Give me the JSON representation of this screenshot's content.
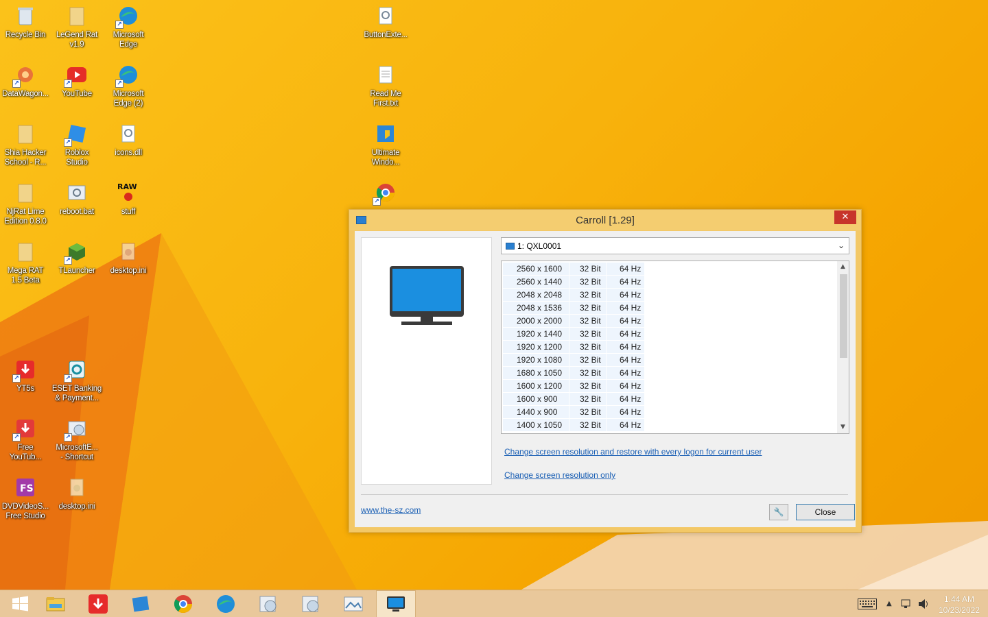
{
  "desktop": {
    "icons": [
      {
        "label": "Recycle Bin",
        "icon": "recycle-bin-icon"
      },
      {
        "label": "LeGend Rat\nv1.9",
        "icon": "folder-icon"
      },
      {
        "label": "Microsoft\nEdge",
        "icon": "edge-icon"
      },
      {
        "label": "ButtonExte...",
        "icon": "settings-file-icon"
      },
      {
        "label": "DataWagon...",
        "icon": "datawagon-icon"
      },
      {
        "label": "YouTube",
        "icon": "youtube-icon"
      },
      {
        "label": "Microsoft\nEdge (2)",
        "icon": "edge-icon"
      },
      {
        "label": "Read Me\nFirst.txt",
        "icon": "text-file-icon"
      },
      {
        "label": "Shia Hacker\nSchool - R...",
        "icon": "folder-icon"
      },
      {
        "label": "Roblox\nStudio",
        "icon": "roblox-studio-icon"
      },
      {
        "label": "icons.dll",
        "icon": "dll-file-icon"
      },
      {
        "label": "Ultimate\nWindo...",
        "icon": "ultimate-windows-icon"
      },
      {
        "label": "NjRat Lime\nEdition 0.8.0",
        "icon": "folder-icon"
      },
      {
        "label": "reboot.bat",
        "icon": "batch-file-icon"
      },
      {
        "label": "stuff",
        "icon": "raw-stuff-icon"
      },
      {
        "label": "",
        "icon": "chrome-icon"
      },
      {
        "label": "Mega RAT\n1.5 Beta",
        "icon": "folder-icon"
      },
      {
        "label": "TLauncher",
        "icon": "tlauncher-icon"
      },
      {
        "label": "desktop.ini",
        "icon": "ini-file-icon"
      },
      {
        "label": "YT5s",
        "icon": "yt5s-icon"
      },
      {
        "label": "ESET Banking\n& Payment...",
        "icon": "eset-icon"
      },
      {
        "label": "Free\nYouTub...",
        "icon": "free-youtube-icon"
      },
      {
        "label": "MicrosoftE...\n- Shortcut",
        "icon": "shortcut-icon"
      },
      {
        "label": "DVDVideoS...\nFree Studio",
        "icon": "dvdvideosoft-icon"
      },
      {
        "label": "desktop.ini",
        "icon": "ini-file-icon"
      }
    ]
  },
  "dialog": {
    "title": "Carroll [1.29]",
    "monitor_select": "1: QXL0001",
    "resolutions": [
      {
        "res": "2560 x 1600",
        "depth": "32 Bit",
        "hz": "64 Hz"
      },
      {
        "res": "2560 x 1440",
        "depth": "32 Bit",
        "hz": "64 Hz"
      },
      {
        "res": "2048 x 2048",
        "depth": "32 Bit",
        "hz": "64 Hz"
      },
      {
        "res": "2048 x 1536",
        "depth": "32 Bit",
        "hz": "64 Hz"
      },
      {
        "res": "2000 x 2000",
        "depth": "32 Bit",
        "hz": "64 Hz"
      },
      {
        "res": "1920 x 1440",
        "depth": "32 Bit",
        "hz": "64 Hz"
      },
      {
        "res": "1920 x 1200",
        "depth": "32 Bit",
        "hz": "64 Hz"
      },
      {
        "res": "1920 x 1080",
        "depth": "32 Bit",
        "hz": "64 Hz"
      },
      {
        "res": "1680 x 1050",
        "depth": "32 Bit",
        "hz": "64 Hz"
      },
      {
        "res": "1600 x 1200",
        "depth": "32 Bit",
        "hz": "64 Hz"
      },
      {
        "res": "1600 x 900",
        "depth": "32 Bit",
        "hz": "64 Hz"
      },
      {
        "res": "1440 x 900",
        "depth": "32 Bit",
        "hz": "64 Hz"
      },
      {
        "res": "1400 x 1050",
        "depth": "32 Bit",
        "hz": "64 Hz"
      }
    ],
    "link_restore": "Change screen resolution and restore with every logon for current user",
    "link_only": "Change screen resolution only",
    "website": "www.the-sz.com",
    "close_label": "Close",
    "close_x": "✕"
  },
  "taskbar": {
    "items": [
      "start-icon",
      "file-explorer-icon",
      "yt5s-downloader-icon",
      "windows-tile-icon",
      "chrome-icon",
      "edge-icon",
      "disc-tool-icon",
      "disc-tool-2-icon",
      "photo-viewer-icon",
      "carroll-monitor-icon"
    ],
    "time": "1:44 AM",
    "date": "10/23/2022"
  },
  "colors": {
    "accent": "#1a5fb4",
    "close_red": "#c7352b",
    "title_bar": "#f4cd70",
    "desktop": "#f8b20c"
  }
}
